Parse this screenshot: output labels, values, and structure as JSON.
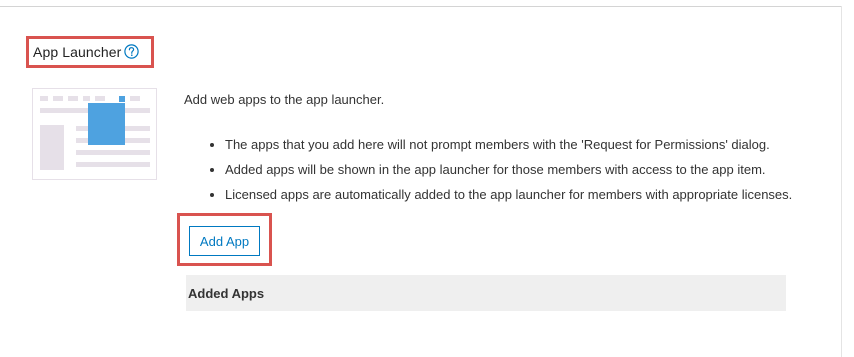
{
  "section": {
    "title": "App Launcher",
    "help_icon": "question-circle-icon"
  },
  "illustration": {
    "icon": "app-launcher-illustration",
    "accent_color": "#4ea2e0",
    "line_color": "#e6e0e8"
  },
  "intro": "Add web apps to the app launcher.",
  "bullets": [
    "The apps that you add here will not prompt members with the 'Request for Permissions' dialog.",
    "Added apps will be shown in the app launcher for those members with access to the app item.",
    "Licensed apps are automatically added to the app launcher for members with appropriate licenses."
  ],
  "actions": {
    "add_app_label": "Add App"
  },
  "added_apps": {
    "header": "Added Apps"
  },
  "colors": {
    "accent": "#0079c1",
    "highlight": "#d9534f",
    "panel": "#efefef"
  }
}
